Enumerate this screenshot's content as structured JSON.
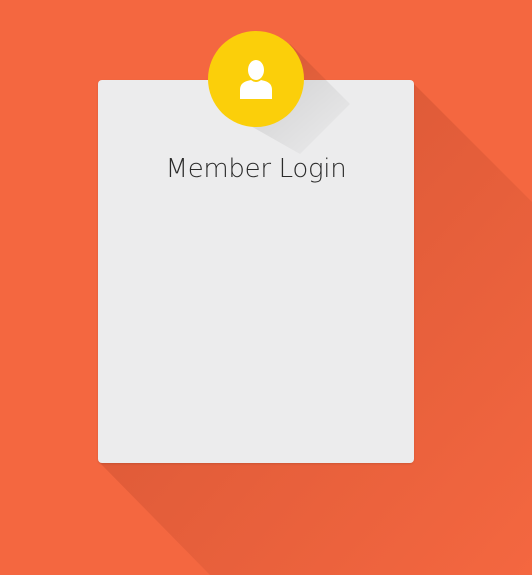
{
  "login": {
    "title": "Member Login"
  },
  "avatar": {
    "icon": "user-icon"
  },
  "colors": {
    "background": "#f46740",
    "card": "#ececed",
    "badge": "#fbcf0a",
    "icon": "#ffffff",
    "title_text": "#2b2b2b"
  }
}
